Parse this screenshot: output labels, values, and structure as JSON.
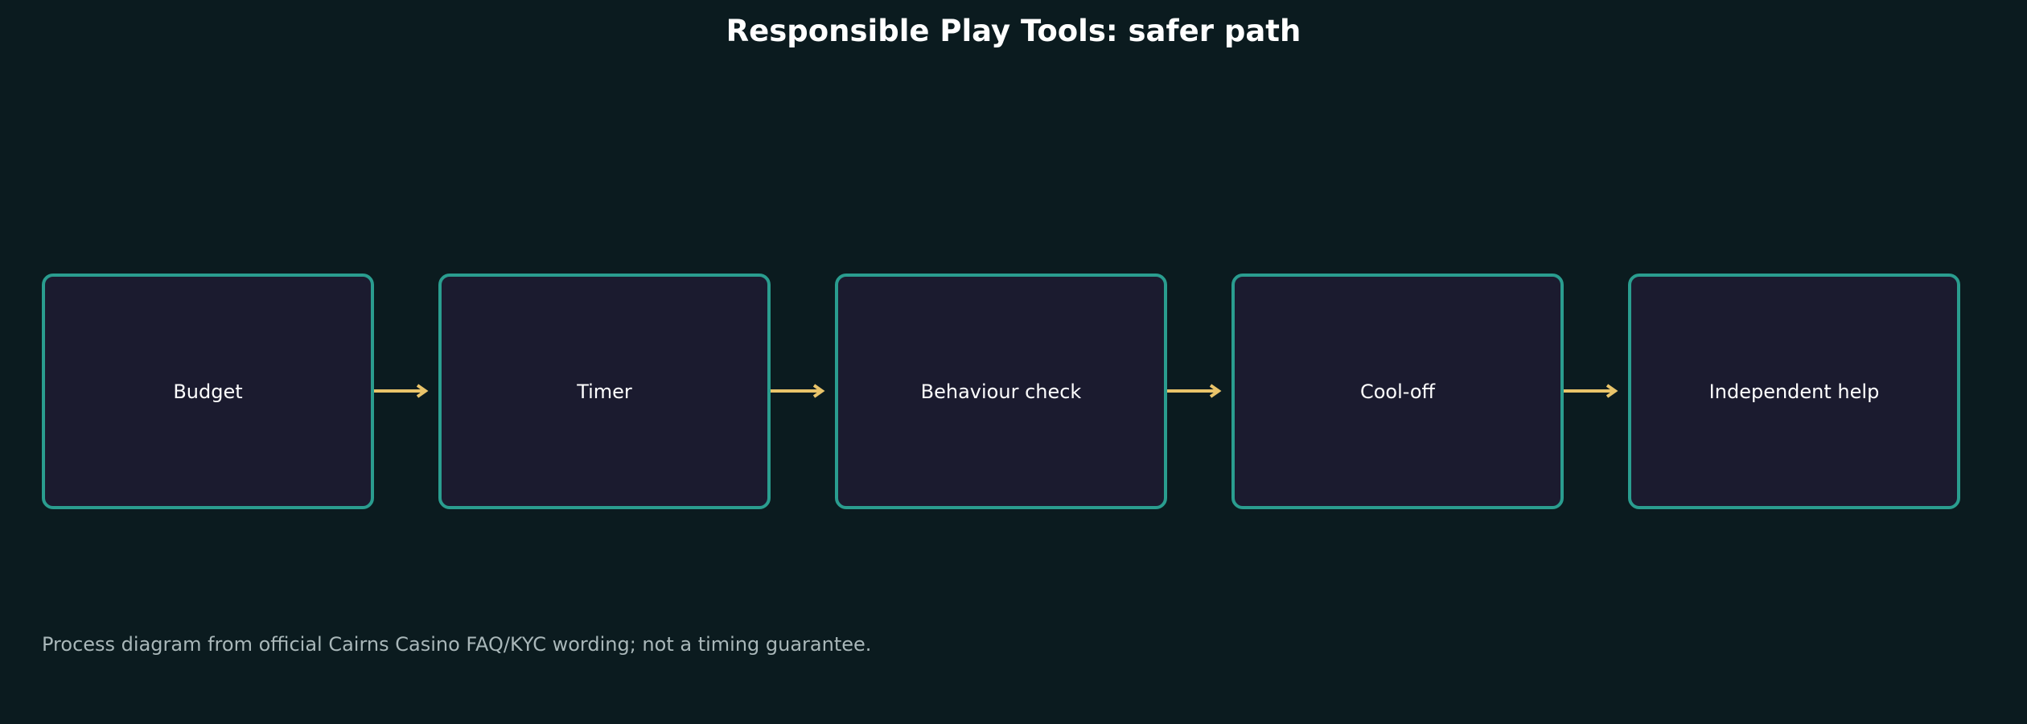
{
  "title": "Responsible Play Tools: safer path",
  "steps": [
    {
      "label": "Budget"
    },
    {
      "label": "Timer"
    },
    {
      "label": "Behaviour check"
    },
    {
      "label": "Cool-off"
    },
    {
      "label": "Independent help"
    }
  ],
  "footnote": "Process diagram from official Cairns Casino FAQ/KYC wording; not a timing guarantee.",
  "colors": {
    "background": "#0b1b1f",
    "box_fill": "#1b1b2f",
    "box_border": "#2a9d8f",
    "arrow": "#e9c46a",
    "text": "#ffffff",
    "footnote": "#a9b7b9"
  }
}
